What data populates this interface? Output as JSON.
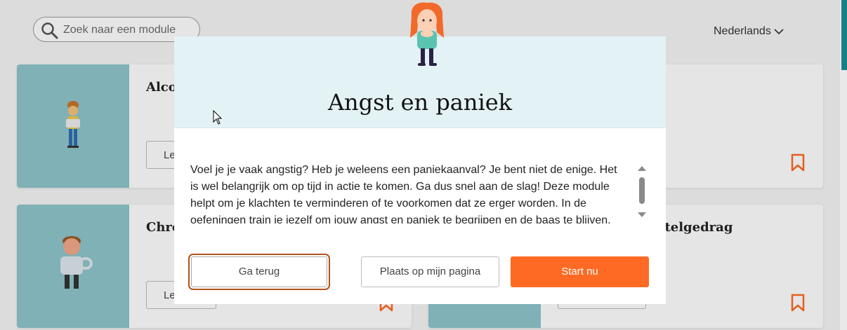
{
  "search": {
    "placeholder": "Zoek naar een module"
  },
  "language": {
    "selected": "Nederlands"
  },
  "cards": [
    {
      "title": "Alcol",
      "button": "Le"
    },
    {
      "title": "Chro",
      "button": "Le"
    },
    {
      "title": "tstelgedrag"
    }
  ],
  "modal": {
    "title": "Angst en paniek",
    "description": "Voel je je vaak angstig? Heb je weleens een paniekaanval? Je bent niet de enige. Het is wel belangrijk om op tijd in actie te komen. Ga dus snel aan de slag! Deze module helpt om je klachten te verminderen of te voorkomen dat ze erger worden. In de oefeningen train je jezelf om jouw angst en paniek te begrijpen en de baas te blijven.",
    "back_label": "Ga terug",
    "place_label": "Plaats op mijn pagina",
    "start_label": "Start nu"
  },
  "colors": {
    "accent": "#fe6a23",
    "thumb": "#8ec6cb",
    "modal_header": "#e3f2f5",
    "focus": "#b5521c",
    "scrollbar": "#1a7f87"
  }
}
